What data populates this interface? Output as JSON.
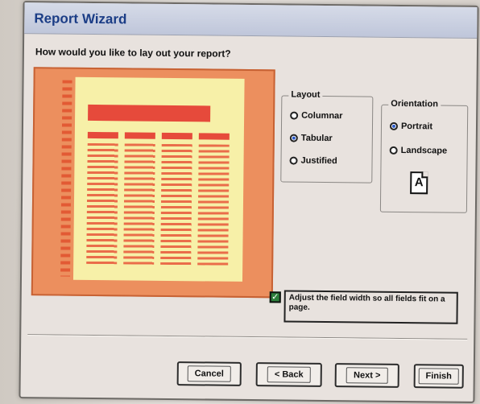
{
  "window": {
    "title": "Report Wizard"
  },
  "question": "How would you like to lay out your report?",
  "layout": {
    "legend": "Layout",
    "options": [
      {
        "label": "Columnar",
        "selected": false
      },
      {
        "label": "Tabular",
        "selected": true
      },
      {
        "label": "Justified",
        "selected": false
      }
    ]
  },
  "orientation": {
    "legend": "Orientation",
    "options": [
      {
        "label": "Portrait",
        "selected": true
      },
      {
        "label": "Landscape",
        "selected": false
      }
    ],
    "page_icon": "A"
  },
  "adjust": {
    "label": "Adjust the field width so all fields fit on a page.",
    "checked": true
  },
  "buttons": {
    "cancel": "Cancel",
    "back": "< Back",
    "next": "Next >",
    "finish": "Finish"
  },
  "colors": {
    "preview_bg": "#ec8f5e",
    "paper": "#f7f0a8",
    "accent_red": "#e64a3b",
    "title_blue": "#1b3d86"
  }
}
